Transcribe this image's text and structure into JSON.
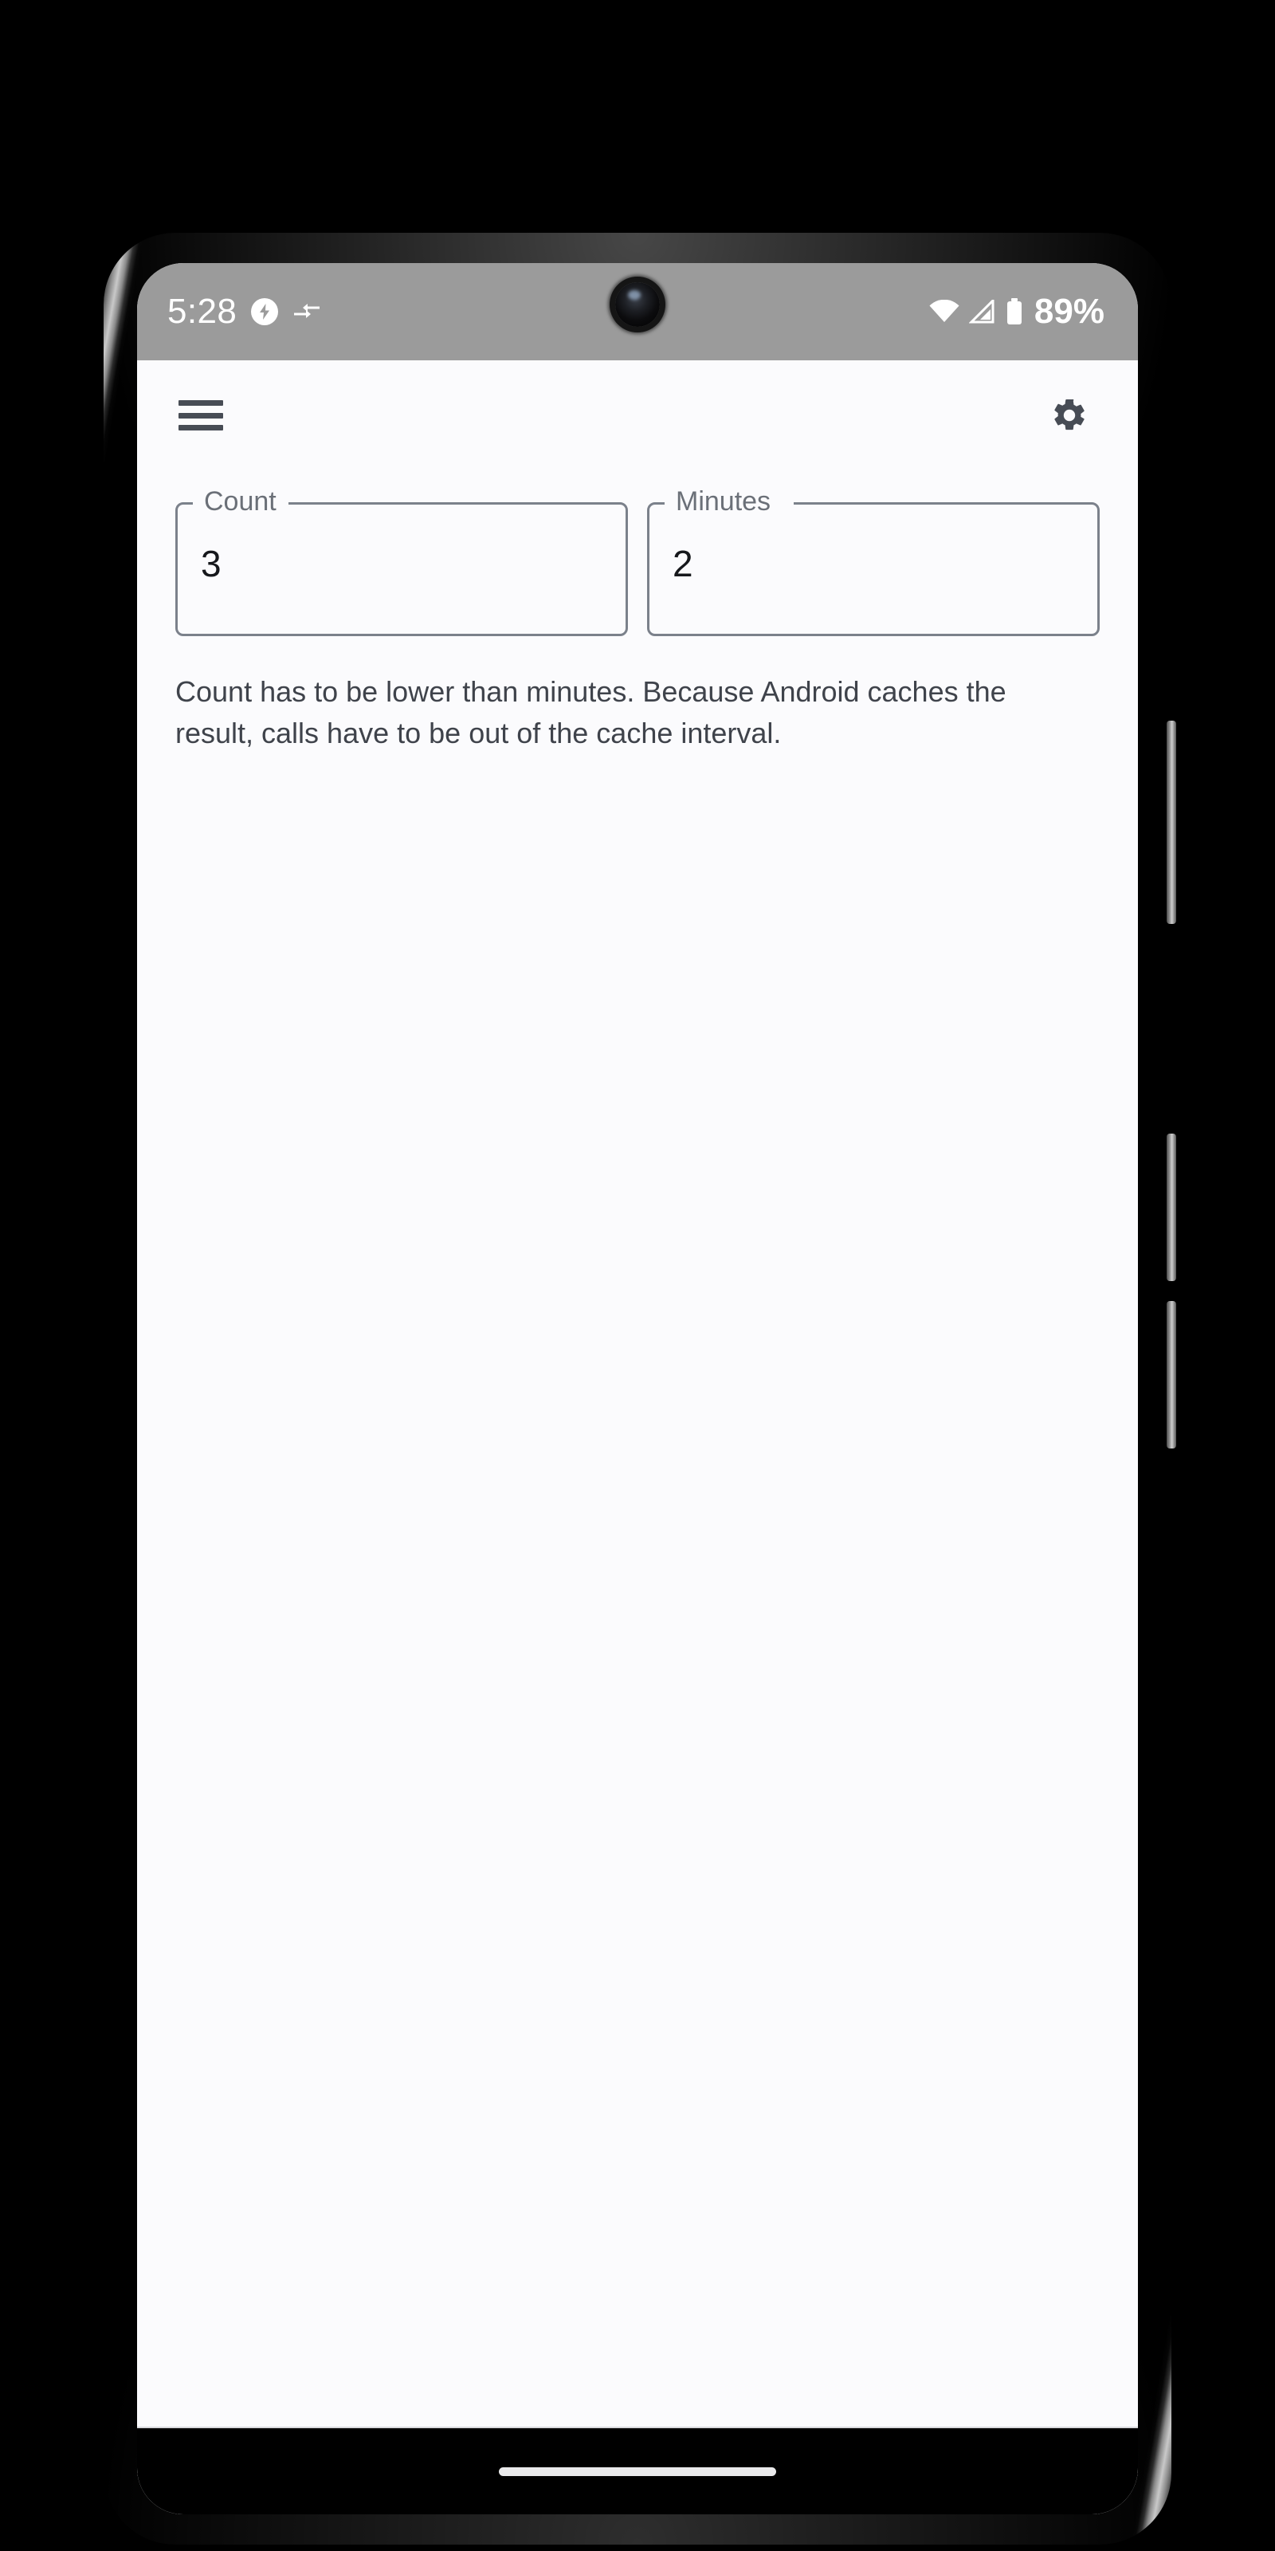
{
  "status_bar": {
    "time": "5:28",
    "battery_percent": "89%",
    "icons": [
      "charging-bolt-icon",
      "data-transfer-icon",
      "wifi-icon",
      "cellular-signal-icon",
      "battery-icon"
    ]
  },
  "app_bar": {
    "menu_icon": "hamburger-menu-icon",
    "settings_icon": "gear-icon"
  },
  "form": {
    "fields": [
      {
        "label": "Count",
        "value": "3"
      },
      {
        "label": "Minutes",
        "value": "2"
      }
    ],
    "helper_text": "Count has to be lower than minutes. Because Android caches the result, calls have to be out of the cache interval."
  },
  "navigation": {
    "gesture_pill": "home-gesture-indicator"
  },
  "colors": {
    "status_bar_bg": "#9b9b9b",
    "screen_bg": "#fbfbfd",
    "icon_color": "#474c55",
    "field_border": "#7b818b",
    "label_color": "#6b7078",
    "value_color": "#16181c",
    "helper_color": "#3f434b",
    "nav_bg": "#000000"
  }
}
